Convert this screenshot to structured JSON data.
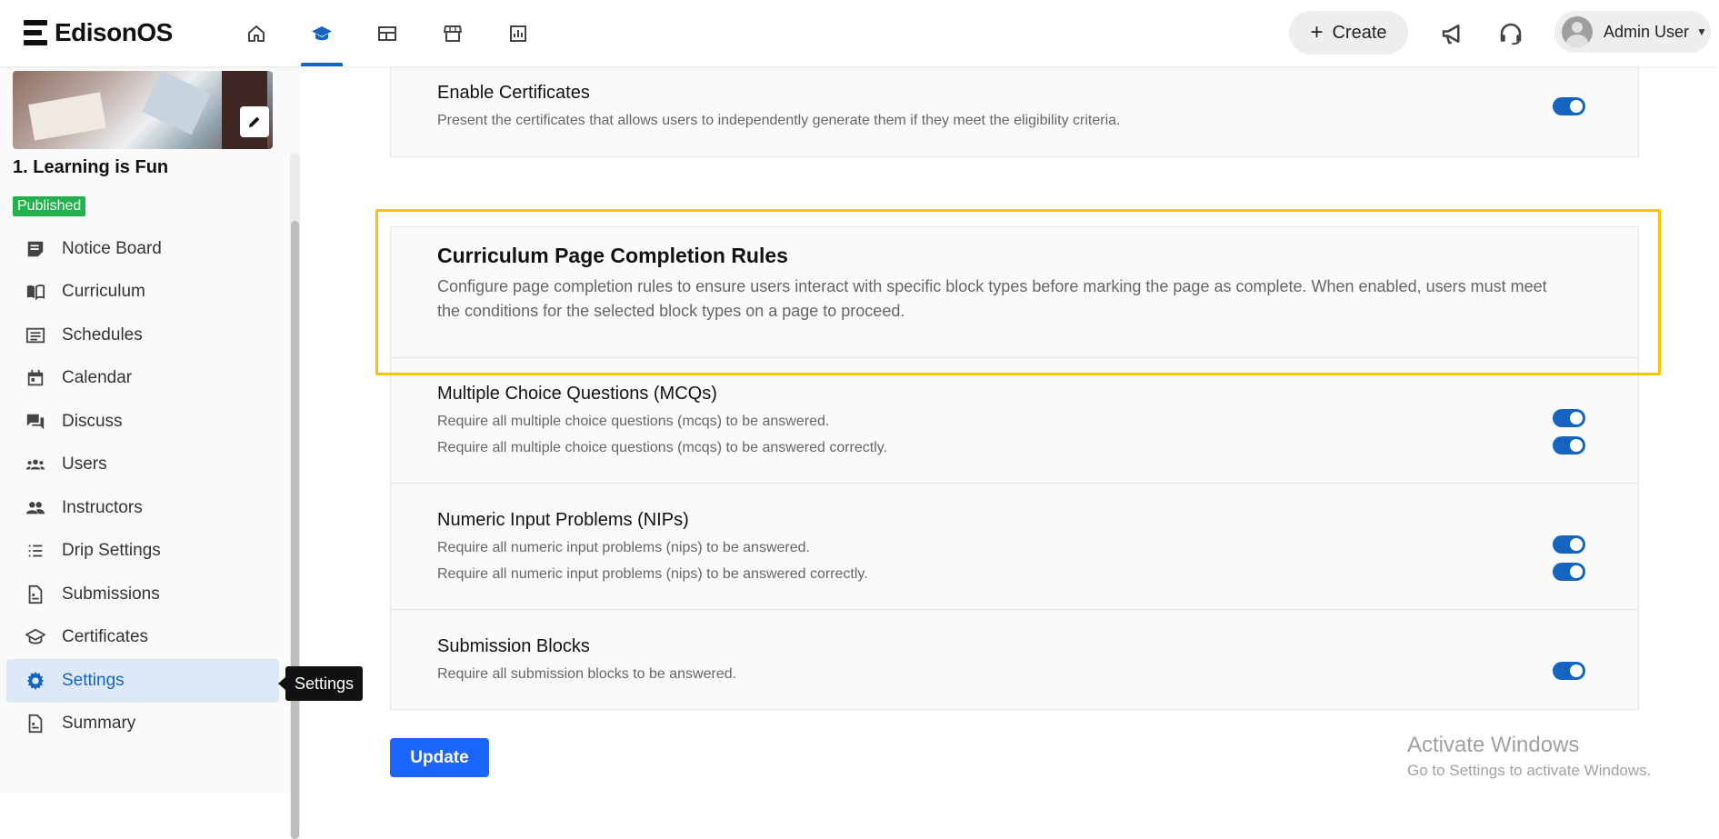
{
  "app": {
    "name": "EdisonOS"
  },
  "header": {
    "nav_icons": [
      "home-icon",
      "graduation-cap-icon",
      "dashboard-icon",
      "storefront-icon",
      "analytics-icon"
    ],
    "active_nav": "graduation-cap-icon",
    "create_label": "Create",
    "user_name": "Admin User"
  },
  "sidebar": {
    "course_title": "1. Learning is Fun",
    "status_badge": "Published",
    "items": [
      {
        "label": "Notice Board",
        "icon": "notice-board-icon"
      },
      {
        "label": "Curriculum",
        "icon": "book-icon"
      },
      {
        "label": "Schedules",
        "icon": "list-icon"
      },
      {
        "label": "Calendar",
        "icon": "calendar-icon"
      },
      {
        "label": "Discuss",
        "icon": "forum-icon"
      },
      {
        "label": "Users",
        "icon": "users-icon"
      },
      {
        "label": "Instructors",
        "icon": "people-icon"
      },
      {
        "label": "Drip Settings",
        "icon": "numbered-list-icon"
      },
      {
        "label": "Submissions",
        "icon": "document-icon"
      },
      {
        "label": "Certificates",
        "icon": "certificate-icon"
      },
      {
        "label": "Settings",
        "icon": "gear-icon",
        "active": true
      },
      {
        "label": "Summary",
        "icon": "summary-icon"
      }
    ],
    "tooltip": "Settings"
  },
  "main": {
    "certificates": {
      "title": "Enable Certificates",
      "description": "Present the certificates that allows users to independently generate them if they meet the eligibility criteria.",
      "enabled": true
    },
    "completion_rules": {
      "title": "Curriculum Page Completion Rules",
      "description": "Configure page completion rules to ensure users interact with specific block types before marking the page as complete. When enabled, users must meet the conditions for the selected block types on a page to proceed.",
      "groups": [
        {
          "title": "Multiple Choice Questions (MCQs)",
          "options": [
            {
              "label": "Require all multiple choice questions (mcqs) to be answered.",
              "enabled": true
            },
            {
              "label": "Require all multiple choice questions (mcqs) to be answered correctly.",
              "enabled": true
            }
          ]
        },
        {
          "title": "Numeric Input Problems (NIPs)",
          "options": [
            {
              "label": "Require all numeric input problems (nips) to be answered.",
              "enabled": true
            },
            {
              "label": "Require all numeric input problems (nips) to be answered correctly.",
              "enabled": true
            }
          ]
        },
        {
          "title": "Submission Blocks",
          "options": [
            {
              "label": "Require all submission blocks to be answered.",
              "enabled": true
            }
          ]
        }
      ]
    },
    "update_label": "Update"
  },
  "watermark": {
    "line1": "Activate Windows",
    "line2": "Go to Settings to activate Windows."
  },
  "colors": {
    "accent": "#1565c0",
    "button": "#1a66ff",
    "published": "#22b14c",
    "highlight": "#f7c600"
  }
}
